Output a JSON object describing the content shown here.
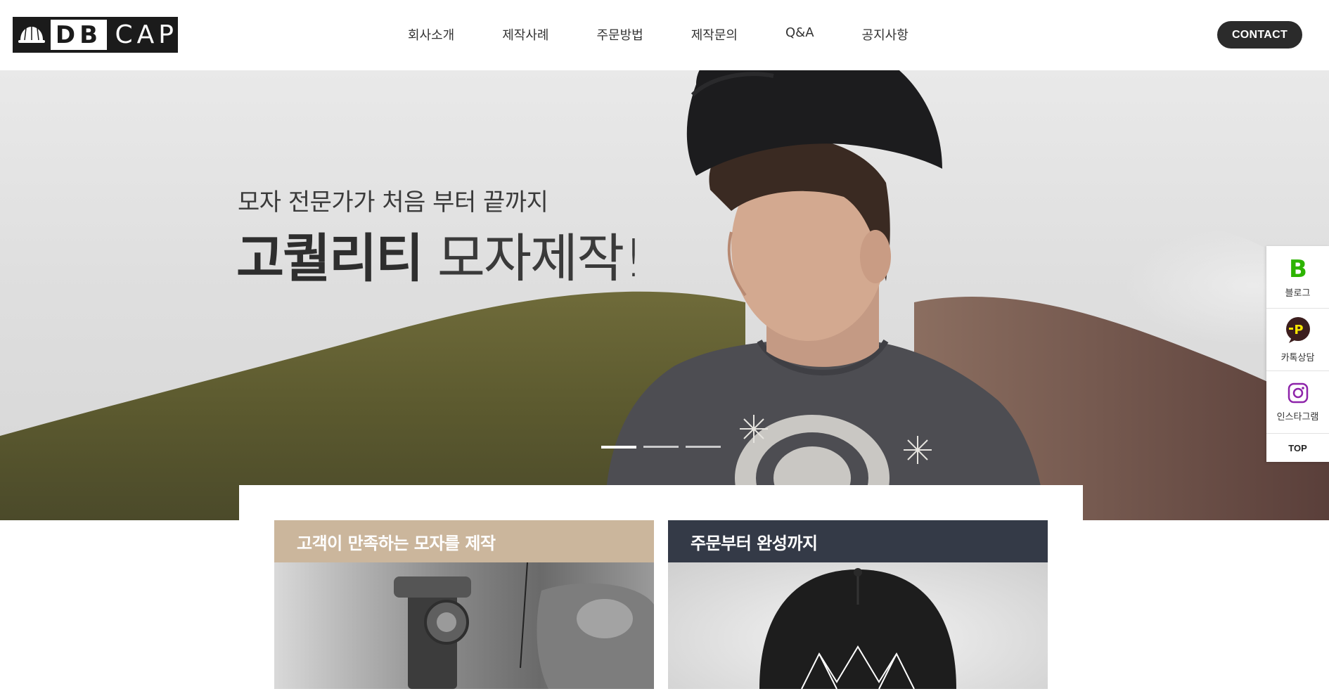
{
  "header": {
    "logo": {
      "db": "DB",
      "cap": "CAP"
    },
    "nav": [
      "회사소개",
      "제작사례",
      "주문방법",
      "제작문의",
      "Q&A",
      "공지사항"
    ],
    "contact_label": "CONTACT"
  },
  "hero": {
    "subtitle": "모자 전문가가 처음 부터 끝까지",
    "title_strong": "고퀄리티",
    "title_light": "모자제작!",
    "slides": 3,
    "active_slide": 1
  },
  "cards": [
    {
      "title": "고객이 만족하는 모자를 제작",
      "header_color": "#cbb69c"
    },
    {
      "title": "주문부터 완성까지",
      "header_color": "#343a47"
    }
  ],
  "quick_menu": {
    "items": [
      {
        "label": "블로그",
        "icon": "blog-icon",
        "color": "#2db400"
      },
      {
        "label": "카톡상담",
        "icon": "kakaotalk-icon",
        "color": "#3c1e1e"
      },
      {
        "label": "인스타그램",
        "icon": "instagram-icon",
        "color": "#8e24aa"
      }
    ],
    "top_label": "TOP"
  }
}
